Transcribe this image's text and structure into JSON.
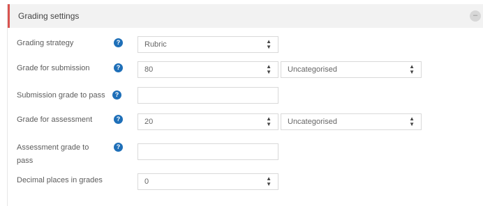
{
  "section": {
    "title": "Grading settings",
    "collapse_icon": "minus-icon"
  },
  "fields": {
    "grading_strategy": {
      "label": "Grading strategy",
      "value": "Rubric"
    },
    "grade_for_submission": {
      "label": "Grade for submission",
      "value": "80",
      "category": "Uncategorised"
    },
    "submission_grade_to_pass": {
      "label": "Submission grade to pass",
      "value": ""
    },
    "grade_for_assessment": {
      "label": "Grade for assessment",
      "value": "20",
      "category": "Uncategorised"
    },
    "assessment_grade_to_pass": {
      "label_line1": "Assessment grade to",
      "label_line2": "pass",
      "value": ""
    },
    "decimal_places": {
      "label": "Decimal places in grades",
      "value": "0"
    }
  },
  "help_glyph": "?",
  "colors": {
    "accent": "#d9534f",
    "help": "#1e6fb8",
    "header_bg": "#f2f2f2"
  }
}
